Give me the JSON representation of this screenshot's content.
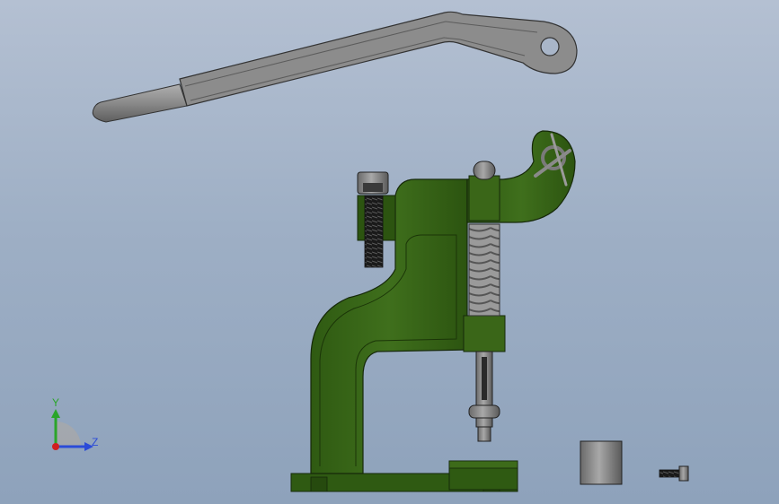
{
  "colors": {
    "background_top": "#b4c0d2",
    "background_bottom": "#8ea2bb",
    "frame_green": "#3f6f1c",
    "frame_dark": "#1f3a0c",
    "steel_gray": "#8a8a8a",
    "steel_dark": "#5a5a5a",
    "thread_black": "#1a1a1a",
    "axis_y": "#2aa52a",
    "axis_z": "#2b4bd8",
    "axis_x": "#d02020"
  },
  "triad": {
    "y_label": "Y",
    "z_label": "Z"
  },
  "parts": {
    "lever_handle": "lever-handle",
    "press_frame": "press-frame",
    "ram_spring": "ram-with-spring",
    "adjust_bolt": "adjust-bolt",
    "die_block": "die-block",
    "loose_sleeve": "sleeve",
    "small_screw": "small-screw"
  }
}
